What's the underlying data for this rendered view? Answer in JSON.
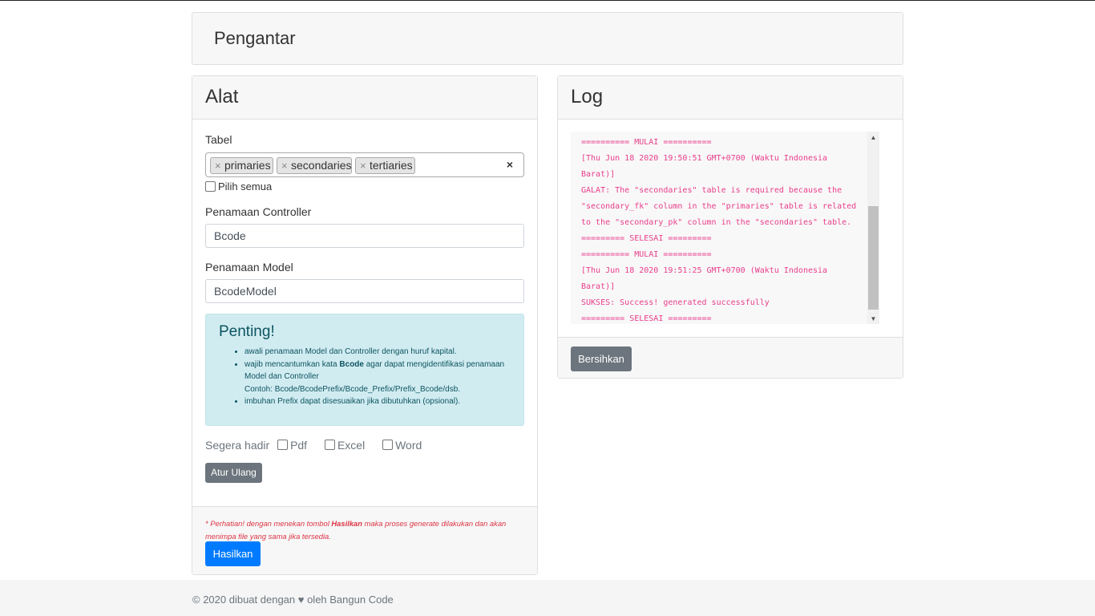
{
  "intro": {
    "title": "Pengantar"
  },
  "alat": {
    "title": "Alat",
    "tabel_label": "Tabel",
    "tags": [
      "primaries",
      "secondaries",
      "tertiaries"
    ],
    "tag_remove_symbol": "×",
    "clear_symbol": "×",
    "select_all_label": "Pilih semua",
    "controller_label": "Penamaan Controller",
    "controller_value": "Bcode",
    "model_label": "Penamaan Model",
    "model_value": "BcodeModel",
    "alert": {
      "title": "Penting!",
      "item1": "awali penamaan Model dan Controller dengan huruf kapital.",
      "item2_pre": "wajib mencantumkan kata ",
      "item2_bold": "Bcode",
      "item2_post": " agar dapat mengidentifikasi penamaan Model dan Controller",
      "item2_example": "Contoh: Bcode/BcodePrefix/Bcode_Prefix/Prefix_Bcode/dsb.",
      "item3": "imbuhan Prefix dapat disesuaikan jika dibutuhkan (opsional)."
    },
    "formats_label": "Segera hadir",
    "format_options": [
      "Pdf",
      "Excel",
      "Word"
    ],
    "reset_label": "Atur Ulang",
    "warning_pre": "* Perhatian! dengan menekan tombol ",
    "warning_bold": "Hasilkan",
    "warning_post": " maka proses generate dilakukan dan akan menimpa file yang sama jika tersedia.",
    "generate_label": "Hasilkan"
  },
  "log": {
    "title": "Log",
    "lines": [
      "========== MULAI ==========",
      "[Thu Jun 18 2020 19:50:51 GMT+0700 (Waktu Indonesia",
      "Barat)]",
      "GALAT: The \"secondaries\" table is required because the",
      "\"secondary_fk\" column in the \"primaries\" table is related",
      "to the \"secondary_pk\" column in the \"secondaries\" table.",
      "========= SELESAI =========",
      "========== MULAI ==========",
      "[Thu Jun 18 2020 19:51:25 GMT+0700 (Waktu Indonesia",
      "Barat)]",
      "SUKSES: Success! generated successfully",
      "========= SELESAI ========="
    ],
    "scroll_up": "▲",
    "scroll_down": "▼",
    "clear_label": "Bersihkan"
  },
  "footer": {
    "text": "© 2020 dibuat dengan ♥ oleh Bangun Code"
  },
  "colors": {
    "primary": "#007bff",
    "secondary": "#6c757d",
    "log_text": "#e83e8c",
    "warning_text": "#dc3545",
    "alert_bg": "#d1ecf1"
  }
}
